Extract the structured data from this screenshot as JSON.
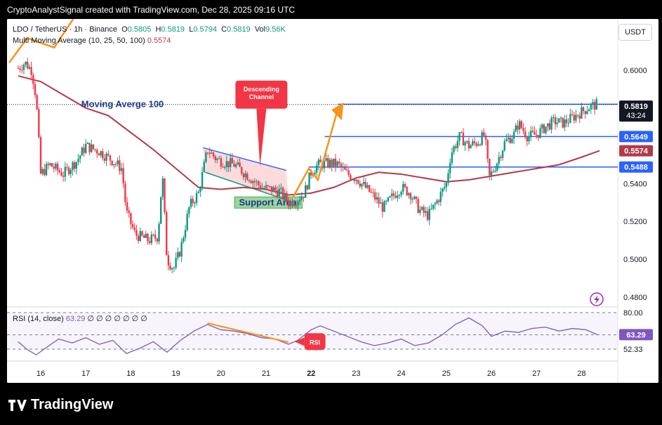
{
  "credit": "CryptoAnalystSignal created with TradingView.com, Dec 28, 2025 09:16 UTC",
  "brand": "TradingView",
  "currency_button": "USDT",
  "header": {
    "symbol": "LDO / TetherUS · 1h · Binance",
    "o_label": "O",
    "o_value": "0.5805",
    "h_label": "H",
    "h_value": "0.5819",
    "l_label": "L",
    "l_value": "0.5794",
    "c_label": "C",
    "c_value": "0.5819",
    "vol_label": "Vol",
    "vol_value": "9.56K",
    "indicator": "Multi Moving Average (10, 25, 50, 100)",
    "indicator_value": "0.5574"
  },
  "rsi_header": {
    "label": "RSI (14, close)",
    "value": "63.29",
    "placeholders": "∅ ∅ ∅ ∅ ∅ ∅ ∅"
  },
  "colors": {
    "up": "#089981",
    "down": "#f23645",
    "ma": "#b23a48",
    "level": "#2962ff",
    "arrow": "#f7931a",
    "rsi": "#7e57c2",
    "support": "#4caf50",
    "channel": "#f23645"
  },
  "annotations": {
    "moving_average": "Moving Averge 100",
    "descending_channel_1": "Descending",
    "descending_channel_2": "Channel",
    "support_area": "Support Area",
    "rsi_callout": "RSI"
  },
  "chart_data": [
    {
      "type": "candlestick",
      "title": "",
      "ylim": [
        0.475,
        0.625
      ],
      "y_ticks": [
        "0.6000",
        "0.5400",
        "0.5200",
        "0.5000",
        "0.4800"
      ],
      "x_ticks": [
        "16",
        "17",
        "18",
        "19",
        "20",
        "21",
        "22",
        "23",
        "24",
        "25",
        "26",
        "27",
        "28"
      ],
      "price_levels": [
        {
          "value": 0.582,
          "label": "0.5820"
        },
        {
          "value": 0.5649,
          "label": "0.5649"
        },
        {
          "value": 0.5488,
          "label": "0.5488"
        }
      ],
      "current_price": {
        "value": 0.5819,
        "label": "0.5819",
        "countdown": "43:24"
      },
      "ma_value": {
        "value": 0.5574,
        "label": "0.5574"
      },
      "price_path": [
        [
          15.5,
          0.601
        ],
        [
          15.65,
          0.604
        ],
        [
          15.8,
          0.6
        ],
        [
          15.9,
          0.585
        ],
        [
          16.0,
          0.545
        ],
        [
          16.2,
          0.55
        ],
        [
          16.5,
          0.545
        ],
        [
          16.8,
          0.552
        ],
        [
          17.0,
          0.56
        ],
        [
          17.3,
          0.557
        ],
        [
          17.6,
          0.552
        ],
        [
          17.8,
          0.548
        ],
        [
          17.9,
          0.525
        ],
        [
          18.1,
          0.513
        ],
        [
          18.4,
          0.51
        ],
        [
          18.6,
          0.512
        ],
        [
          18.7,
          0.545
        ],
        [
          18.8,
          0.5
        ],
        [
          18.95,
          0.495
        ],
        [
          19.1,
          0.505
        ],
        [
          19.3,
          0.528
        ],
        [
          19.5,
          0.535
        ],
        [
          19.7,
          0.558
        ],
        [
          19.9,
          0.553
        ],
        [
          20.1,
          0.551
        ],
        [
          20.3,
          0.55
        ],
        [
          20.5,
          0.546
        ],
        [
          20.7,
          0.542
        ],
        [
          20.9,
          0.538
        ],
        [
          21.1,
          0.537
        ],
        [
          21.3,
          0.536
        ],
        [
          21.5,
          0.53
        ],
        [
          21.65,
          0.531
        ],
        [
          21.85,
          0.535
        ],
        [
          22.0,
          0.546
        ],
        [
          22.15,
          0.55
        ],
        [
          22.4,
          0.551
        ],
        [
          22.6,
          0.55
        ],
        [
          22.8,
          0.545
        ],
        [
          23.0,
          0.543
        ],
        [
          23.2,
          0.538
        ],
        [
          23.4,
          0.533
        ],
        [
          23.6,
          0.527
        ],
        [
          23.8,
          0.533
        ],
        [
          24.0,
          0.538
        ],
        [
          24.2,
          0.535
        ],
        [
          24.4,
          0.526
        ],
        [
          24.6,
          0.523
        ],
        [
          24.8,
          0.531
        ],
        [
          25.0,
          0.54
        ],
        [
          25.1,
          0.556
        ],
        [
          25.3,
          0.565
        ],
        [
          25.5,
          0.56
        ],
        [
          25.7,
          0.562
        ],
        [
          25.85,
          0.566
        ],
        [
          25.95,
          0.543
        ],
        [
          26.1,
          0.55
        ],
        [
          26.3,
          0.562
        ],
        [
          26.5,
          0.566
        ],
        [
          26.6,
          0.572
        ],
        [
          26.8,
          0.565
        ],
        [
          27.0,
          0.566
        ],
        [
          27.2,
          0.57
        ],
        [
          27.4,
          0.573
        ],
        [
          27.6,
          0.572
        ],
        [
          27.8,
          0.575
        ],
        [
          28.0,
          0.578
        ],
        [
          28.2,
          0.581
        ],
        [
          28.35,
          0.5819
        ]
      ],
      "moving_average_100": [
        [
          15.5,
          0.597
        ],
        [
          16.0,
          0.594
        ],
        [
          16.5,
          0.587
        ],
        [
          17.0,
          0.58
        ],
        [
          17.5,
          0.576
        ],
        [
          18.0,
          0.567
        ],
        [
          18.5,
          0.558
        ],
        [
          19.0,
          0.548
        ],
        [
          19.5,
          0.538
        ],
        [
          20.0,
          0.537
        ],
        [
          20.5,
          0.538
        ],
        [
          21.0,
          0.537
        ],
        [
          21.5,
          0.534
        ],
        [
          22.0,
          0.535
        ],
        [
          22.5,
          0.538
        ],
        [
          23.0,
          0.543
        ],
        [
          23.5,
          0.546
        ],
        [
          24.0,
          0.545
        ],
        [
          24.5,
          0.543
        ],
        [
          25.0,
          0.541
        ],
        [
          25.5,
          0.542
        ],
        [
          26.0,
          0.544
        ],
        [
          26.5,
          0.546
        ],
        [
          27.0,
          0.548
        ],
        [
          27.5,
          0.55
        ],
        [
          28.0,
          0.554
        ],
        [
          28.4,
          0.5574
        ]
      ]
    },
    {
      "type": "line",
      "title": "",
      "ylim": [
        45,
        85
      ],
      "y_ticks": [
        "80.00",
        "63.17",
        "52.33"
      ],
      "levels": [
        80,
        63.17,
        52.33
      ],
      "current": {
        "value": 63.29,
        "label": "63.29"
      },
      "rsi_path": [
        [
          15.5,
          58
        ],
        [
          15.7,
          52
        ],
        [
          15.9,
          48
        ],
        [
          16.1,
          53
        ],
        [
          16.4,
          60
        ],
        [
          16.7,
          57
        ],
        [
          17.0,
          61
        ],
        [
          17.3,
          56
        ],
        [
          17.6,
          59
        ],
        [
          17.9,
          49
        ],
        [
          18.2,
          53
        ],
        [
          18.5,
          58
        ],
        [
          18.8,
          50
        ],
        [
          19.1,
          59
        ],
        [
          19.4,
          66
        ],
        [
          19.7,
          71
        ],
        [
          20.0,
          67
        ],
        [
          20.3,
          66
        ],
        [
          20.6,
          64
        ],
        [
          20.9,
          61
        ],
        [
          21.2,
          60
        ],
        [
          21.5,
          56
        ],
        [
          21.7,
          59
        ],
        [
          22.0,
          67
        ],
        [
          22.2,
          70
        ],
        [
          22.5,
          66
        ],
        [
          22.8,
          62
        ],
        [
          23.1,
          58
        ],
        [
          23.4,
          55
        ],
        [
          23.7,
          57
        ],
        [
          24.0,
          60
        ],
        [
          24.3,
          55
        ],
        [
          24.6,
          57
        ],
        [
          24.9,
          63
        ],
        [
          25.2,
          71
        ],
        [
          25.5,
          76
        ],
        [
          25.8,
          70
        ],
        [
          26.0,
          62
        ],
        [
          26.3,
          66
        ],
        [
          26.6,
          65
        ],
        [
          26.9,
          68
        ],
        [
          27.2,
          69
        ],
        [
          27.5,
          66
        ],
        [
          27.8,
          68
        ],
        [
          28.1,
          67
        ],
        [
          28.35,
          63.29
        ]
      ]
    }
  ]
}
